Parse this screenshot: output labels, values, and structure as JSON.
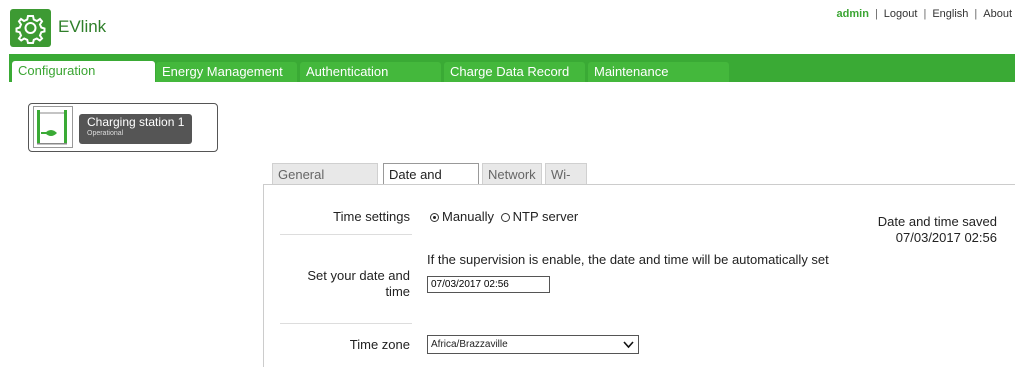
{
  "header": {
    "app_name": "EVlink",
    "user": "admin",
    "links": [
      "Logout",
      "English",
      "About"
    ],
    "separator": "|"
  },
  "main_tabs": [
    {
      "label": "Configuration",
      "active": true
    },
    {
      "label": "Energy Management",
      "active": false
    },
    {
      "label": "Authentication",
      "active": false
    },
    {
      "label": "Charge Data Record",
      "active": false
    },
    {
      "label": "Maintenance",
      "active": false
    }
  ],
  "station": {
    "name": "Charging station 1",
    "status": "Operational"
  },
  "sub_tabs": [
    {
      "label": "General Settings",
      "active": false
    },
    {
      "label": "Date and Time",
      "active": true
    },
    {
      "label": "Network",
      "active": false
    },
    {
      "label": "Wi-Fi",
      "active": false
    }
  ],
  "date_time": {
    "time_settings_label": "Time settings",
    "option_manual": "Manually",
    "option_ntp": "NTP server",
    "selected_option": "Manually",
    "saved_title": "Date and time saved",
    "saved_value": "07/03/2017 02:56",
    "supervision_note": "If the supervision is enable, the date and time will be automatically set",
    "set_date_label_line1": "Set your date and",
    "set_date_label_line2": "time",
    "date_value": "07/03/2017 02:56",
    "timezone_label": "Time zone",
    "timezone_value": "Africa/Brazzaville"
  },
  "colors": {
    "brand_green": "#3aaa35",
    "tab_green": "#44b83c",
    "station_label_bg": "#555555"
  },
  "icons": {
    "logo": "gear-icon",
    "station": "ev-charger-icon",
    "dropdown": "chevron-down-icon"
  }
}
